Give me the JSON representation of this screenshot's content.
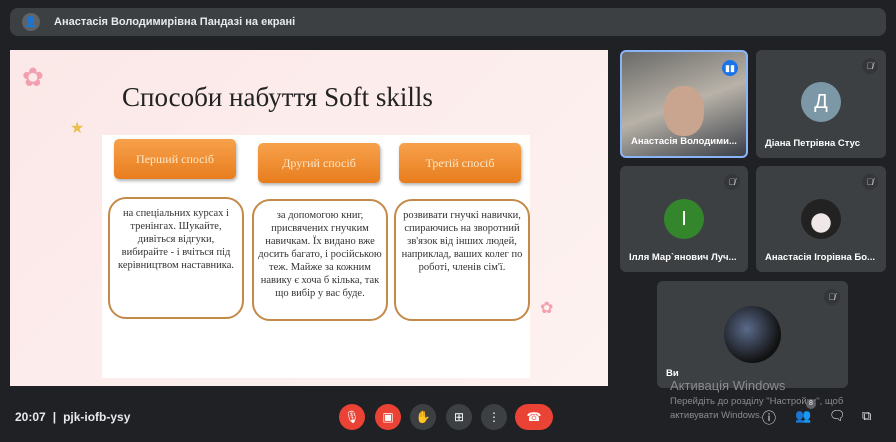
{
  "presenter_banner": "Анастасія Володимирівна Пандазі на екрані",
  "slide": {
    "title_ua": "Способи набуття",
    "title_en": "Soft skills",
    "columns": [
      {
        "header": "Перший спосіб",
        "text": "на спеціальних курсах і тренінгах. Шукайте, дивіться відгуки, вибирайте - і вчіться під керівництвом наставника."
      },
      {
        "header": "Другий спосіб",
        "text": "за допомогою книг, присвячених гнучким навичкам. Їх видано вже досить багато, і російською теж. Майже за кожним навику є хоча б кілька, так що вибір у вас буде."
      },
      {
        "header": "Третій спосіб",
        "text": "розвивати гнучкі навички, спираючись на зворотний зв'язок від інших людей, наприклад, ваших колег по роботі, членів сім'ї."
      }
    ]
  },
  "participants": [
    {
      "name": "Анастасія Володими...",
      "speaking": true
    },
    {
      "name": "Діана Петрівна Стус",
      "initial": "Д",
      "color": "#7c98a6"
    },
    {
      "name": "Ілля Мар`янович Луч...",
      "initial": "І",
      "color": "#33862b"
    },
    {
      "name": "Анастасія Ігорівна Бо..."
    },
    {
      "name": "Ви"
    }
  ],
  "bottom": {
    "time": "20:07",
    "separator": "|",
    "meeting_code": "pjk-iofb-ysy",
    "people_count": "8"
  },
  "watermark": {
    "title": "Активація Windows",
    "line1": "Перейдіть до розділу \"Настройки\", щоб",
    "line2": "активувати Windows."
  }
}
